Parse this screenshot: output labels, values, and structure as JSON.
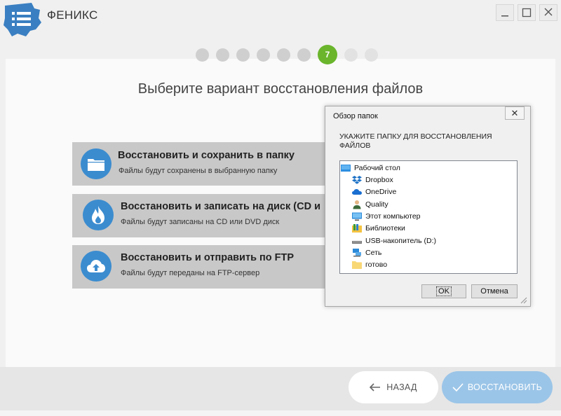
{
  "app": {
    "title": "ФЕНИКС"
  },
  "steps": {
    "active_label": "7"
  },
  "main": {
    "heading": "Выберите вариант восстановления файлов",
    "options": [
      {
        "title": "Восстановить и сохранить в папку",
        "subtitle": "Файлы будут сохранены в выбранную папку",
        "icon": "folder-icon"
      },
      {
        "title": "Восстановить и записать на диск (CD и",
        "subtitle": "Файлы будут записаны на CD или DVD диск",
        "icon": "flame-icon"
      },
      {
        "title": "Восстановить и отправить по FTP",
        "subtitle": "Файлы будут переданы на FTP-сервер",
        "icon": "cloud-upload-icon"
      }
    ]
  },
  "footer": {
    "back_label": "НАЗАД",
    "restore_label": "ВОССТАНОВИТЬ"
  },
  "dialog": {
    "title": "Обзор папок",
    "close_glyph": "✕",
    "instruction": "УКАЖИТЕ ПАПКУ ДЛЯ ВОССТАНОВЛЕНИЯ ФАЙЛОВ",
    "tree": [
      {
        "label": "Рабочий стол",
        "icon": "desktop-icon"
      },
      {
        "label": "Dropbox",
        "icon": "dropbox-icon"
      },
      {
        "label": "OneDrive",
        "icon": "onedrive-icon"
      },
      {
        "label": "Quality",
        "icon": "user-icon"
      },
      {
        "label": "Этот компьютер",
        "icon": "computer-icon"
      },
      {
        "label": "Библиотеки",
        "icon": "library-icon"
      },
      {
        "label": "USB-накопитель (D:)",
        "icon": "usb-drive-icon"
      },
      {
        "label": "Сеть",
        "icon": "network-icon"
      },
      {
        "label": "готово",
        "icon": "folder-icon"
      }
    ],
    "ok_label": "OK",
    "cancel_label": "Отмена"
  },
  "colors": {
    "accent_blue": "#3b8ccf",
    "step_green": "#6ab52c",
    "restore_button": "#9bc5e8"
  }
}
